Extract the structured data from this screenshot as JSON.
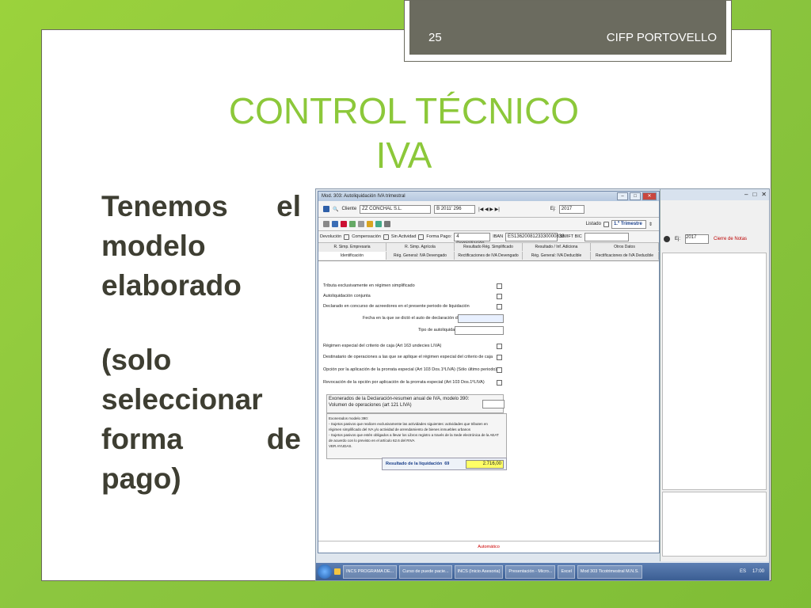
{
  "header": {
    "slide_number": "25",
    "organization": "CIFP PORTOVELLO"
  },
  "title": {
    "line1": "CONTROL TÉCNICO",
    "line2": "IVA"
  },
  "body": {
    "para1": [
      "Tenemos el",
      "modelo",
      "elaborado"
    ],
    "para2": [
      "(solo",
      "seleccionar",
      "forma de",
      "pago)"
    ]
  },
  "screenshot": {
    "window_title": "Mod. 303: Autoliquidación IVA trimestral",
    "client_label": "Cliente",
    "client_name": "ZZ CONCHAL S.L.",
    "client_id": "B 2011' 296",
    "ej_label": "Ej:",
    "ej_value": "2017",
    "listado_label": "Listado",
    "period": "1.º Trimestre",
    "row3": [
      "Devolución",
      "Compensación",
      "Sin Actividad",
      "Forma Pago:",
      "4 Domiciliación Banc",
      "IBAN",
      "ES1362008123330000838",
      "SWIFT BIC"
    ],
    "tabs_row1": [
      "R. Simp. Empresaria",
      "R. Simp. Agrícola",
      "Resultado Rég. Simplificado",
      "Resultado / Inf. Adiciona",
      "Otros Datos"
    ],
    "tabs_row2": [
      "Identificación",
      "Rég. General: IVA Devengado",
      "Rectificaciones de IVA Devengado",
      "Rég. General: IVA Deducible",
      "Rectificaciones de IVA Deducible"
    ],
    "lines": [
      "Tributa exclusivamente en régimen simplificado",
      "Autoliquidación conjunta",
      "Declarado en concurso de acreedores en el presente periodo de liquidación",
      "Fecha en la que se dictó el auto de declaración de concurso",
      "Tipo de autoliquidación",
      "Régimen especial del criterio de caja (Art 163 undecies LIVA)",
      "Destinatario de operaciones a las que se aplique el régimen especial del criterio de caja",
      "Opción por la aplicación de la prorrata especial (Art 103 Dos.1ºLIVA) (Sólo último periodo)",
      "Revocación de la opción por aplicación de la prorrata especial (Art 103 Dos.1ºLIVA)"
    ],
    "box_lines": [
      "Exonerados de la Declaración-resumen anual de IVA, modelo 390:",
      "Volumen de operaciones (art 121 LIVA)"
    ],
    "info_lines": [
      "Exonerados modelo 390:",
      "- Sujetos pasivos que realicen exclusivamente las actividades siguientes: actividades que tributen en",
      "  régimen simplificado del IVA y/o actividad de arrendamiento de bienes inmuebles urbanos",
      "- Sujetos pasivos que estén obligados a llevar los Libros registro a través de la Sede electrónica de la AEAT",
      "  de acuerdo con lo previsto en el artículo 62.6 del RIVA",
      "VER AYUDAS."
    ],
    "result_label": "Resultado de la liquidación",
    "result_code": "69",
    "result_value": "2.716,00",
    "status": "Automático",
    "bg_window": {
      "ej_label": "Ej:",
      "ej_value": "2017",
      "right_label": "Cierre de Notas"
    },
    "taskbar": {
      "items": [
        "INCS PROGRAMA DE...",
        "Curso de puede pacie...",
        "INCS (Inicio Asesoria)",
        "Presentación - Micro...",
        "Excel",
        "Mod 303 Ticotrimestral M.N.S."
      ],
      "lang": "ES",
      "time": "17:00"
    }
  }
}
